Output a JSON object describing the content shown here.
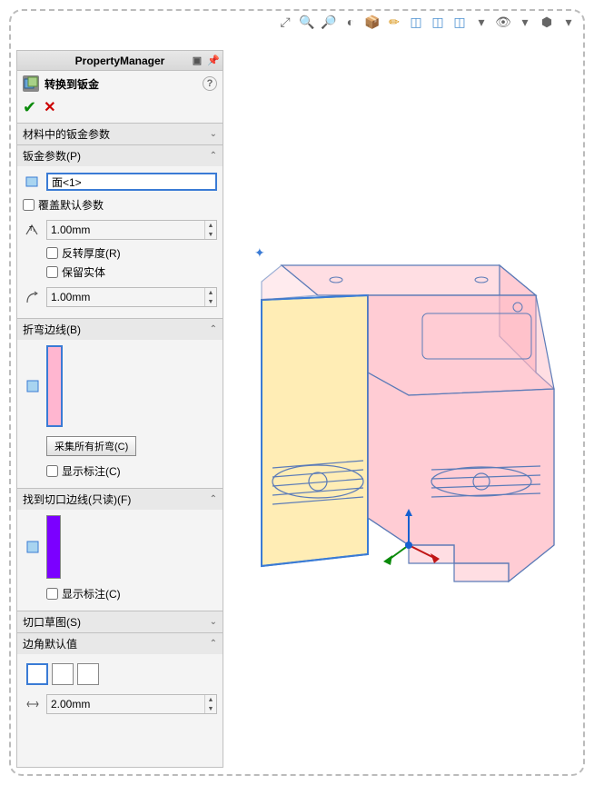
{
  "panel": {
    "header": "PropertyManager",
    "feature_title": "转换到钣金",
    "help": "?"
  },
  "sections": {
    "material": {
      "title": "材料中的钣金参数"
    },
    "params": {
      "title": "钣金参数(P)",
      "face_value": "面<1>",
      "override": "覆盖默认参数",
      "thickness_value": "1.00mm",
      "reverse": "反转厚度(R)",
      "keep": "保留实体",
      "radius_value": "1.00mm"
    },
    "bends": {
      "title": "折弯边线(B)",
      "collect_btn": "采集所有折弯(C)",
      "show_markers": "显示标注(C)"
    },
    "rips": {
      "title": "找到切口边线(只读)(F)",
      "show_markers": "显示标注(C)"
    },
    "sketch": {
      "title": "切口草图(S)"
    },
    "corners": {
      "title": "边角默认值",
      "gap_value": "2.00mm"
    }
  }
}
